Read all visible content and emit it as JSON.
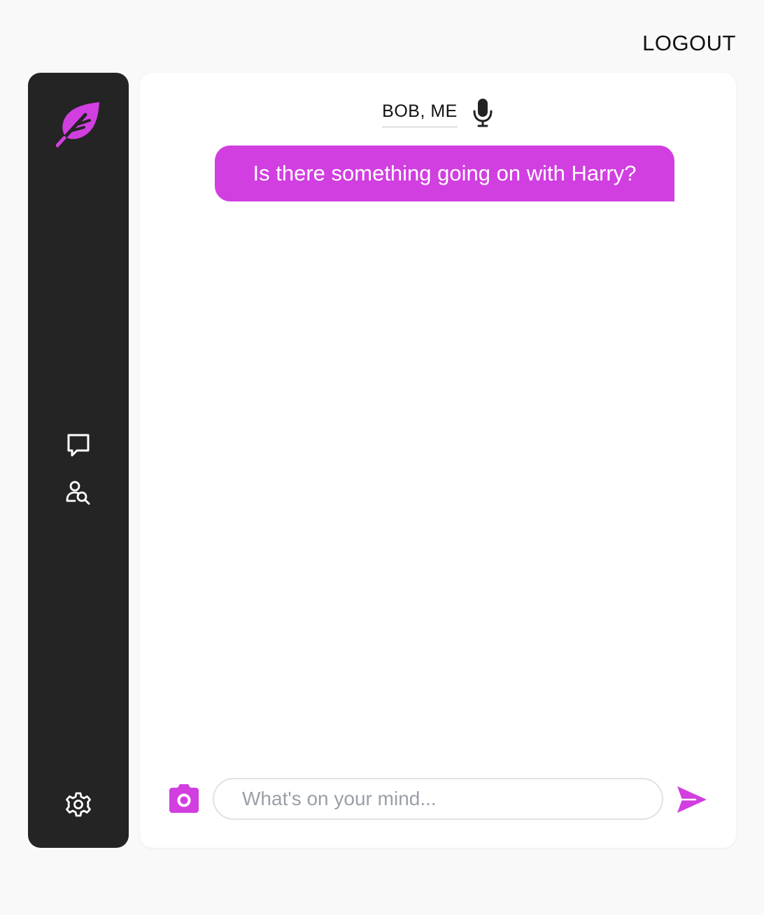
{
  "app": {
    "logout_label": "LOGOUT",
    "accent_color": "#d13fe0",
    "sidebar_color": "#242424"
  },
  "sidebar": {
    "logo_icon": "feather-icon",
    "items": [
      {
        "name": "chats",
        "icon": "message-square-icon"
      },
      {
        "name": "find-user",
        "icon": "user-search-icon"
      }
    ],
    "settings_icon": "gear-icon"
  },
  "chat": {
    "participants": "BOB, ME",
    "mic_icon": "microphone-icon",
    "messages": [
      {
        "from": "me",
        "text": "Is there something going on with Harry?"
      }
    ]
  },
  "composer": {
    "placeholder": "What's on your mind...",
    "value": "",
    "camera_icon": "camera-icon",
    "send_icon": "send-icon"
  }
}
